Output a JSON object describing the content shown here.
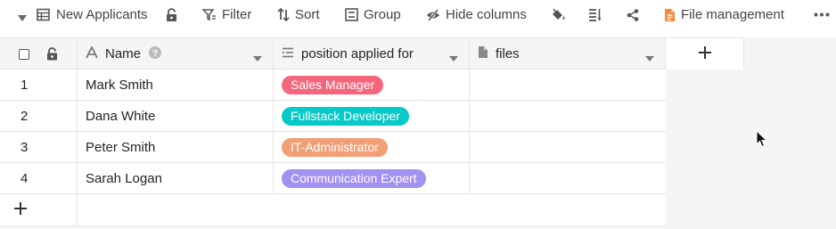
{
  "toolbar": {
    "view_name": "New Applicants",
    "filter_label": "Filter",
    "sort_label": "Sort",
    "group_label": "Group",
    "hide_columns_label": "Hide columns",
    "file_management_label": "File management",
    "icons": [
      "caret-down-icon",
      "table-view-icon",
      "lock-icon",
      "filter-icon",
      "sort-icon",
      "group-icon",
      "hide-columns-icon",
      "paint-bucket-icon",
      "row-height-icon",
      "share-icon",
      "file-management-icon",
      "more-icon"
    ]
  },
  "columns": [
    {
      "label": "Name",
      "icon": "text-column-icon"
    },
    {
      "label": "position applied for",
      "icon": "single-select-icon"
    },
    {
      "label": "files",
      "icon": "file-column-icon"
    }
  ],
  "rows": [
    {
      "index": "1",
      "name": "Mark Smith",
      "position": "Sales Manager",
      "position_color": "#f4667c"
    },
    {
      "index": "2",
      "name": "Dana White",
      "position": "Fullstack Developer",
      "position_color": "#07c9c7"
    },
    {
      "index": "3",
      "name": "Peter Smith",
      "position": "IT-Administrator",
      "position_color": "#f29e76"
    },
    {
      "index": "4",
      "name": "Sarah Logan",
      "position": "Communication Expert",
      "position_color": "#a391f2"
    }
  ],
  "colors": {
    "file_management_accent": "#f08a3e",
    "header_bg": "#f5f5f5",
    "grid_line": "#e3e3e3"
  }
}
